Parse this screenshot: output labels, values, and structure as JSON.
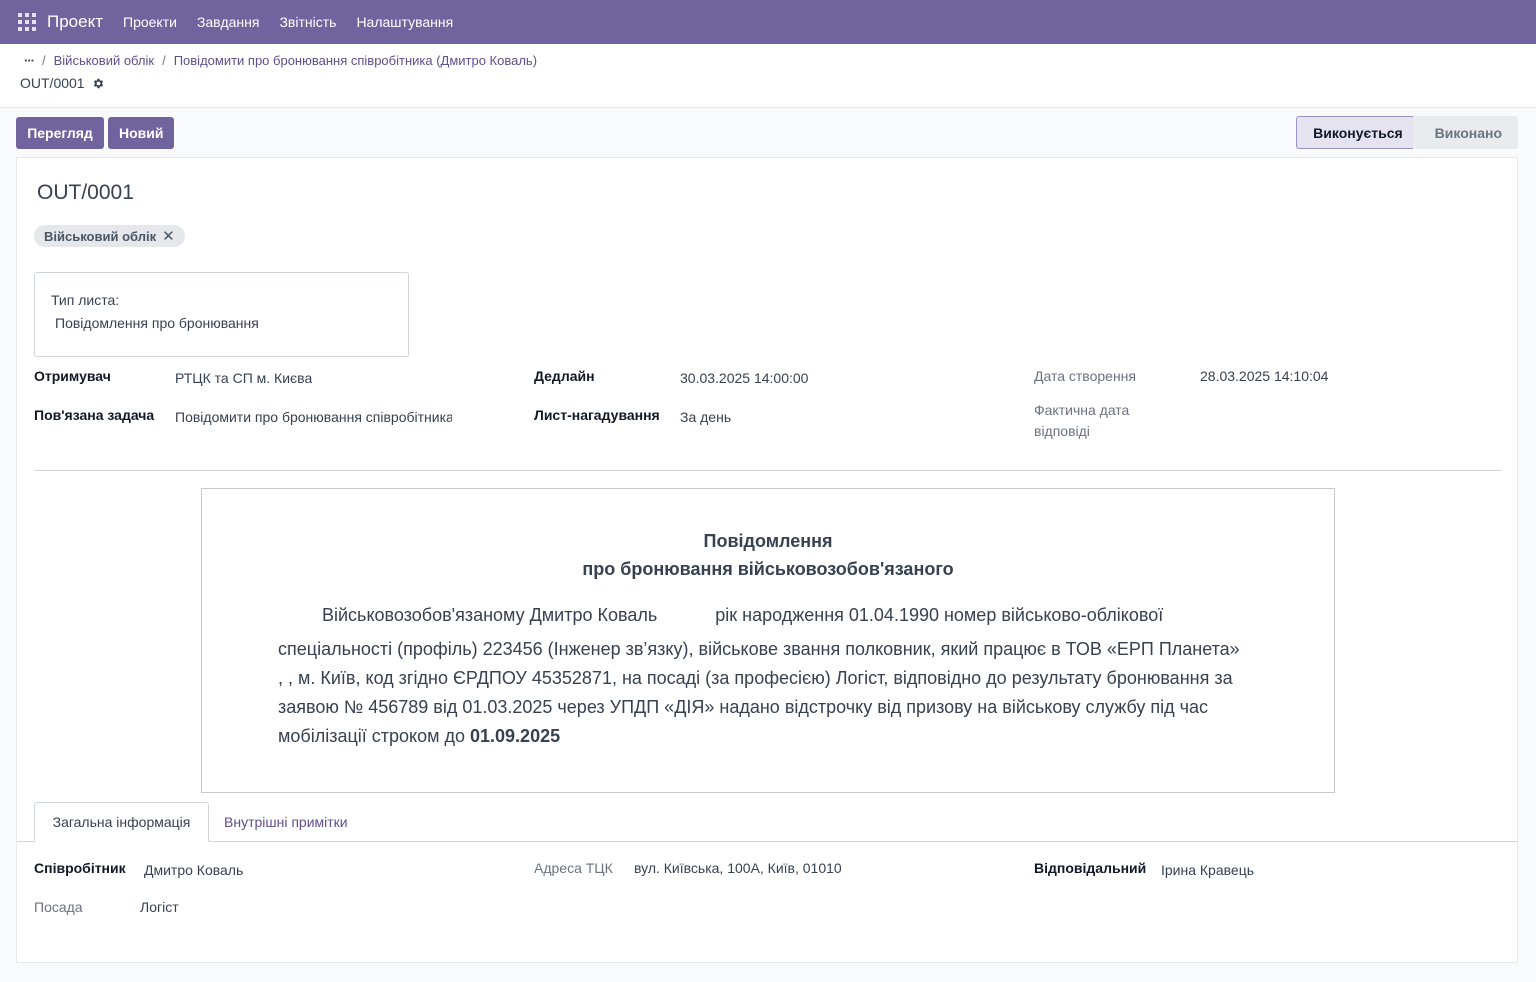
{
  "navbar": {
    "brand": "Проект",
    "menu": [
      "Проекти",
      "Завдання",
      "Звітність",
      "Налаштування"
    ]
  },
  "breadcrumb": {
    "items": [
      "Військовий облік",
      "Повідомити про бронювання співробітника (Дмитро Коваль)"
    ],
    "record": "OUT/0001"
  },
  "actions": {
    "view_label": "Перегляд",
    "new_label": "Новий"
  },
  "status": {
    "current": "Виконується",
    "next": "Виконано"
  },
  "form": {
    "title": "OUT/0001",
    "tag": "Військовий облік",
    "letter_type_label": "Тип листа:",
    "letter_type_value": "Повідомлення про бронювання",
    "fields": {
      "recipient_label": "Отримувач",
      "recipient_value": "РТЦК та СП м. Києва",
      "task_label": "Пов'язана задача",
      "task_value": "Повідомити про бронювання співробітника (Дмитро Коваль)",
      "deadline_label": "Дедлайн",
      "deadline_value": "30.03.2025 14:00:00",
      "reminder_label": "Лист-нагадування",
      "reminder_value": "За день",
      "created_label": "Дата створення",
      "created_value": "28.03.2025 14:10:04",
      "actual_reply_label_1": "Фактична дата",
      "actual_reply_label_2": "відповіді"
    }
  },
  "letter": {
    "title_1": "Повідомлення",
    "title_2": "про бронювання військовозобов'язаного",
    "first_line_a": "Військовозобов'язаному  Дмитро Коваль",
    "first_line_b": "рік народження 01.04.1990 номер військово-облікової",
    "line_2": "спеціальності (профіль) 223456 (Інженер зв’язку), військове звання полковник, який працює в ТОВ «ЕРП Планета»",
    "line_3": ", , м. Київ, код згідно ЄРДПОУ 45352871, на посаді (за професією) Логіст, відповідно до результату бронювання за",
    "line_4": "заявою № 456789 від 01.03.2025 через УПДП «ДІЯ» надано відстрочку від призову на військову службу під час",
    "line_5_a": "мобілізації строком до ",
    "line_5_b": "01.09.2025"
  },
  "tabs": {
    "general": "Загальна інформація",
    "notes": "Внутрішні примітки"
  },
  "general": {
    "employee_label": "Співробітник",
    "employee_value": "Дмитро Коваль",
    "position_label": "Посада",
    "position_value": "Логіст",
    "tck_label": "Адреса ТЦК",
    "tck_value": "вул. Київська, 100А, Київ, 01010",
    "responsible_label": "Відповідальний",
    "responsible_value": "Ірина Кравець"
  },
  "colors": {
    "navbar": "#71639e",
    "accent_link": "#5e4f8f"
  }
}
